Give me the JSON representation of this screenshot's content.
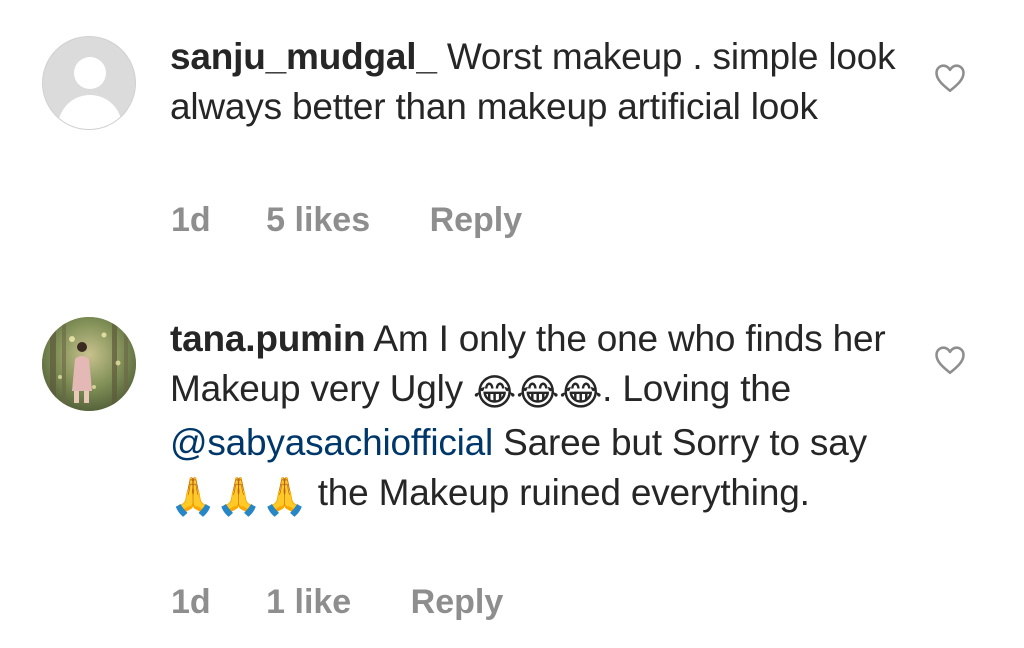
{
  "comments": [
    {
      "username": "sanju_mudgal_",
      "text": "Worst makeup . simple look always better than makeup artificial look",
      "time": "1d",
      "likes": "5 likes",
      "reply": "Reply",
      "avatar": "default-avatar-icon"
    },
    {
      "username": "tana.pumin",
      "text_1": "Am I only the one who finds her Makeup very Ugly",
      "laugh_emoji": "😂",
      "text_2": ". Loving the",
      "mention": "@sabyasachiofficial",
      "text_3": "Saree but Sorry to say",
      "pray_emoji": "🙏",
      "text_4": "the Makeup ruined everything.",
      "time": "1d",
      "likes": "1 like",
      "reply": "Reply",
      "avatar": "profile-photo"
    }
  ],
  "icons": {
    "like": "heart-outline-icon"
  },
  "colors": {
    "text": "#262626",
    "meta": "#8e8e8e",
    "mention": "#00376b",
    "avatar_bg": "#dbdbdb"
  }
}
